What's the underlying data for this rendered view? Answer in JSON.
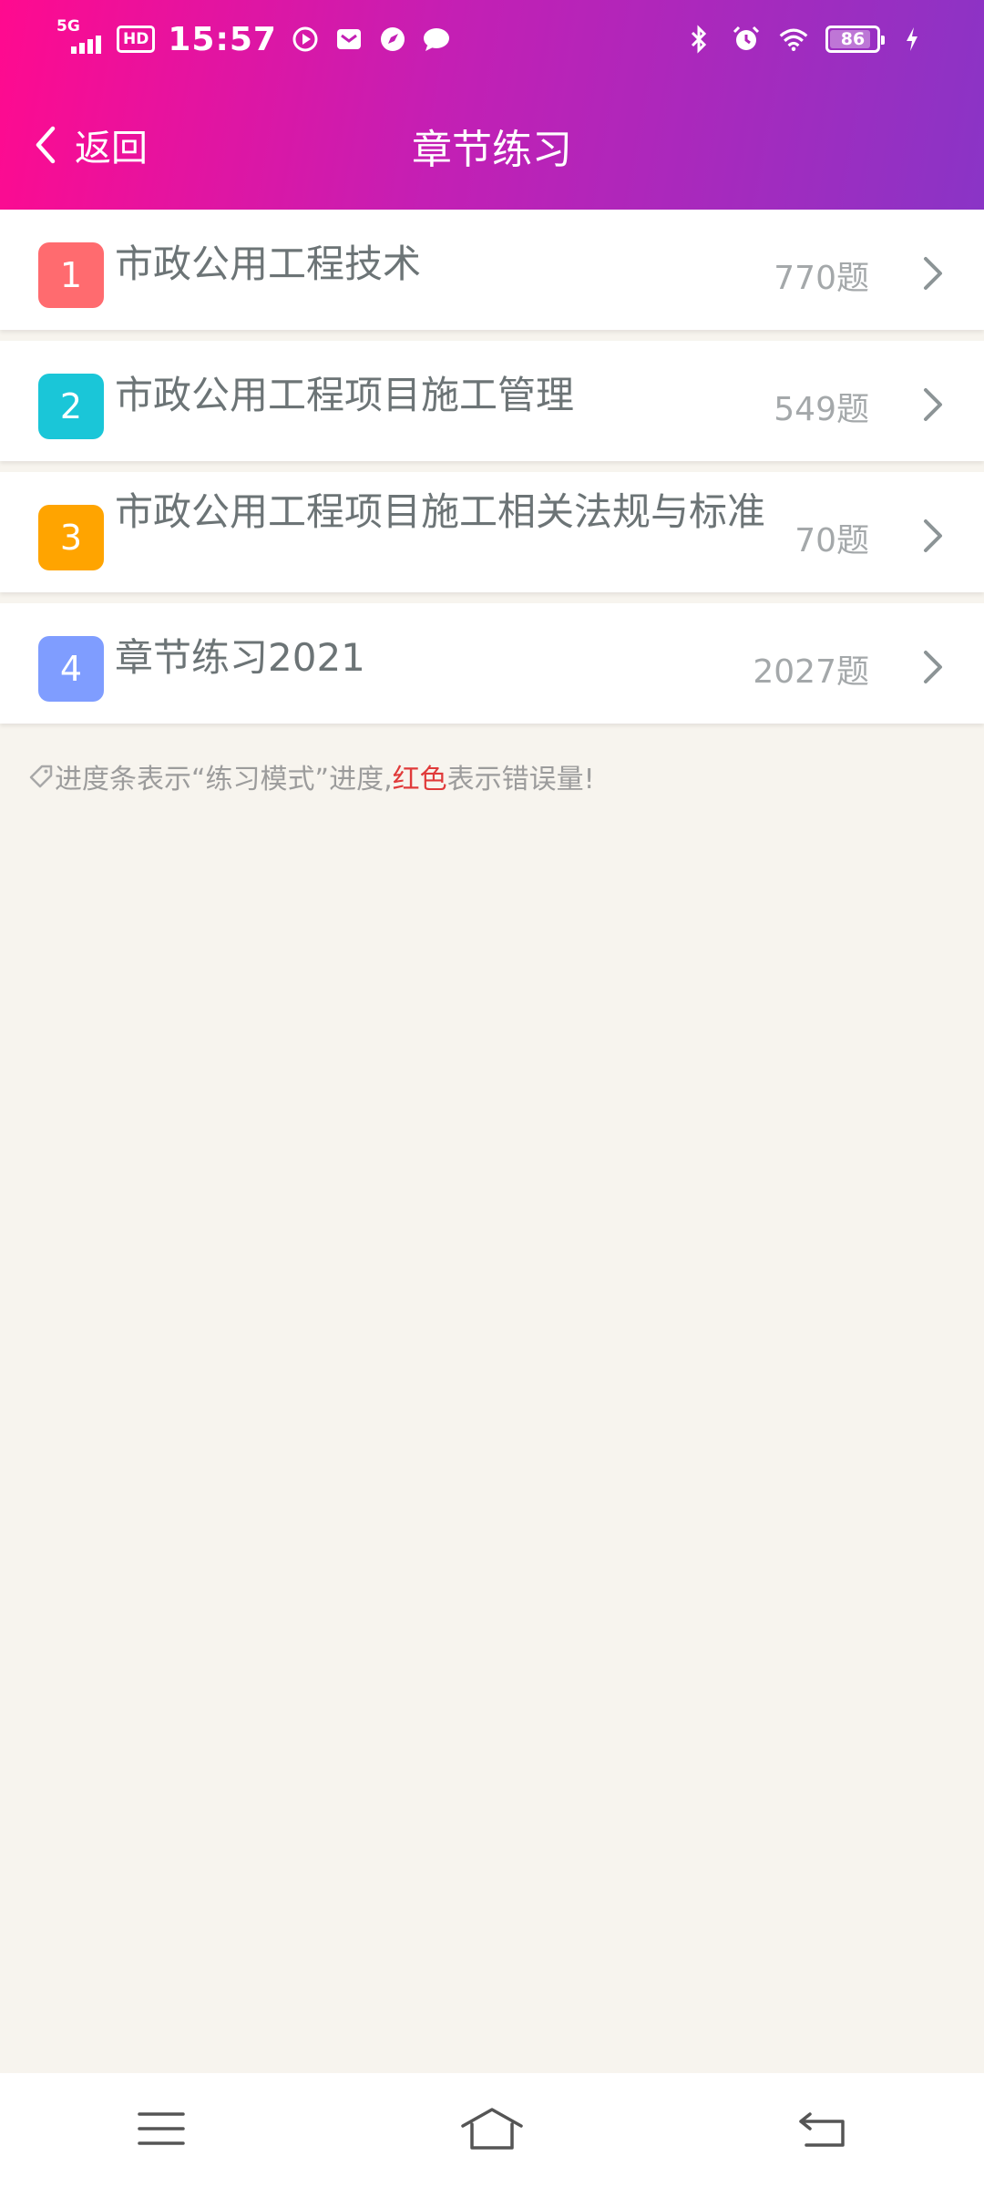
{
  "status_bar": {
    "network": "5G",
    "hd": "HD",
    "time": "15:57",
    "battery": "86"
  },
  "nav": {
    "back_label": "返回",
    "title": "章节练习"
  },
  "chapters": [
    {
      "number": "1",
      "title": "市政公用工程技术",
      "count": "770题",
      "color": "#ff6b6f"
    },
    {
      "number": "2",
      "title": "市政公用工程项目施工管理",
      "count": "549题",
      "color": "#1ac6d8"
    },
    {
      "number": "3",
      "title": "市政公用工程项目施工相关法规与标准",
      "count": "70题",
      "color": "#ffa400"
    },
    {
      "number": "4",
      "title": "章节练习2021",
      "count": "2027题",
      "color": "#7f9dff"
    }
  ],
  "tip": {
    "part1": "进度条表示“练习模式”进度,",
    "red": "红色",
    "part2": "表示错误量!"
  }
}
